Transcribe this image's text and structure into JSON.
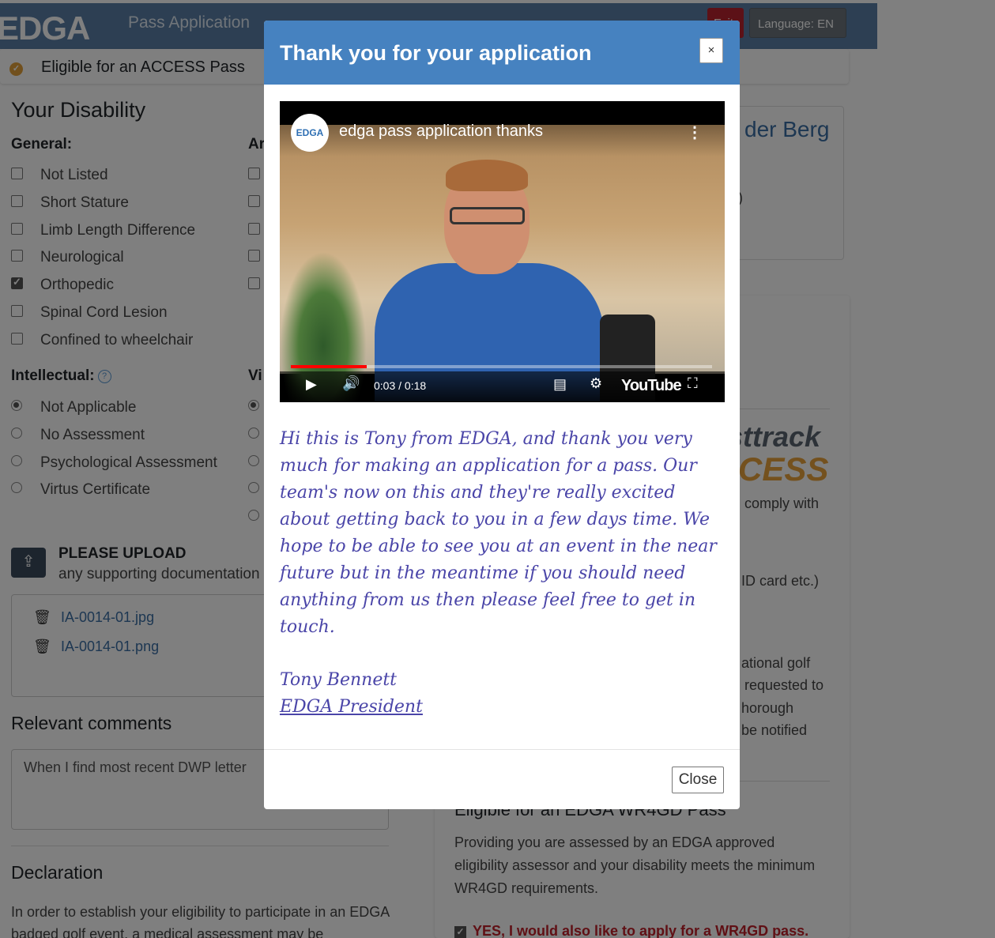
{
  "header": {
    "logo": "EDGA",
    "app_title": "Pass Application",
    "exit_label": "Exit",
    "language_label": "Language: EN"
  },
  "eligibility": {
    "icon": "check-circle-icon",
    "text": "Eligible for an ACCESS Pass"
  },
  "disability": {
    "heading": "Your Disability",
    "general_label": "General:",
    "arm_label_partial": "Ar",
    "general_options": [
      {
        "label": "Not Listed",
        "checked": false
      },
      {
        "label": "Short Stature",
        "checked": false
      },
      {
        "label": "Limb Length Difference",
        "checked": false
      },
      {
        "label": "Neurological",
        "checked": false
      },
      {
        "label": "Orthopedic",
        "checked": true
      },
      {
        "label": "Spinal Cord Lesion",
        "checked": false
      },
      {
        "label": "Confined to wheelchair",
        "checked": false
      }
    ],
    "intellectual_label": "Intellectual:",
    "visual_label_partial": "Vi",
    "intellectual_options": [
      {
        "label": "Not Applicable",
        "selected": true
      },
      {
        "label": "No Assessment",
        "selected": false
      },
      {
        "label": "Psychological Assessment",
        "selected": false
      },
      {
        "label": "Virtus Certificate",
        "selected": false
      }
    ]
  },
  "upload": {
    "title": "PLEASE UPLOAD",
    "subtitle": "any supporting documentation",
    "files": [
      "IA-0014-01.jpg",
      "IA-0014-01.png"
    ]
  },
  "comments": {
    "heading": "Relevant comments",
    "value": "When I find most recent DWP letter"
  },
  "declaration": {
    "heading": "Declaration",
    "text": "In order to establish your eligibility to participate in an EDGA badged golf event, a medical assessment may be"
  },
  "right_panel": {
    "name_partial": "der Berg",
    "paren": ")",
    "fasttrack_partial": "sttrack",
    "access_partial": "CESS",
    "comply": "comply with",
    "id_card": "ID card etc.)",
    "national_lines": [
      "ational golf",
      "requested to",
      "horough",
      "be notified"
    ],
    "wr4gd_title": "Eligible for an EDGA WR4GD Pass",
    "wr4gd_text": "Providing you are assessed by an EDGA approved eligibility assessor and your disability meets the minimum WR4GD requirements.",
    "wr4gd_checkbox": "YES, I would also like to apply for a WR4GD pass."
  },
  "modal": {
    "title": "Thank you for your application",
    "close_x": "×",
    "video": {
      "channel_logo": "EDGA",
      "title": "edga pass application thanks",
      "time": "0:03 / 0:18",
      "progress": 0.18,
      "brand": "YouTube"
    },
    "message": "Hi this is Tony from EDGA, and thank you very much for making an application for a pass. Our team's now on this and they're really excited about getting back to you in a few days time. We hope to be able to see you at an event in the near future but in the meantime if you should need anything from us then please feel free to get in touch.",
    "signature_name": "Tony Bennett",
    "signature_role": "EDGA President",
    "close_label": "Close"
  }
}
